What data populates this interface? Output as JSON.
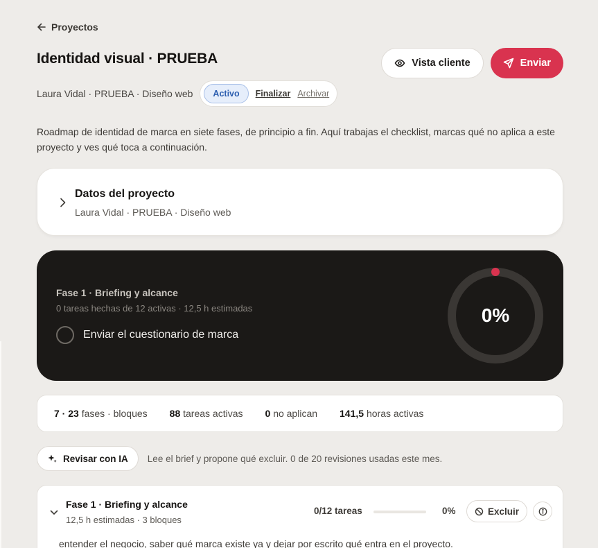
{
  "nav": {
    "back_label": "Proyectos"
  },
  "project": {
    "title": "Identidad visual · PRUEBA",
    "meta": "Laura Vidal · PRUEBA · Diseño web",
    "status": "Activo",
    "finalize_label": "Finalizar",
    "archive_label": "Archivar"
  },
  "actions": {
    "client_view_label": "Vista cliente",
    "send_label": "Enviar"
  },
  "intro": "Roadmap de identidad de marca en siete fases, de principio a fin. Aquí trabajas el checklist, marcas qué no aplica a este proyecto y ves qué toca a continuación.",
  "details_card": {
    "title": "Datos del proyecto",
    "subtitle": "Laura Vidal · PRUEBA · Diseño web"
  },
  "hero": {
    "phase": "Fase 1 · Briefing y alcance",
    "summary": "0 tareas hechas de 12 activas · 12,5 h estimadas",
    "next_task": "Enviar el cuestionario de marca",
    "progress_label": "0%",
    "progress": 0
  },
  "stats": {
    "phases_blocks_value": "7 · 23",
    "phases_blocks_label": "fases · bloques",
    "active_tasks_value": "88",
    "active_tasks_label": "tareas activas",
    "not_applicable_value": "0",
    "not_applicable_label": "no aplican",
    "active_hours_value": "141,5",
    "active_hours_label": "horas activas"
  },
  "ai": {
    "button_label": "Revisar con IA",
    "note": "Lee el brief y propone qué excluir. 0 de 20 revisiones usadas este mes."
  },
  "phase_card": {
    "title": "Fase 1 · Briefing y alcance",
    "subtitle": "12,5 h estimadas · 3 bloques",
    "task_count": "0/12 tareas",
    "progress": 0,
    "pct_label": "0%",
    "exclude_label": "Excluir",
    "description": "entender el negocio, saber qué marca existe ya y dejar por escrito qué entra en el proyecto."
  },
  "colors": {
    "accent": "#d9334f",
    "background": "#eeece9",
    "hero_bg": "#1b1917",
    "status_blue": "#2d5fb0"
  }
}
